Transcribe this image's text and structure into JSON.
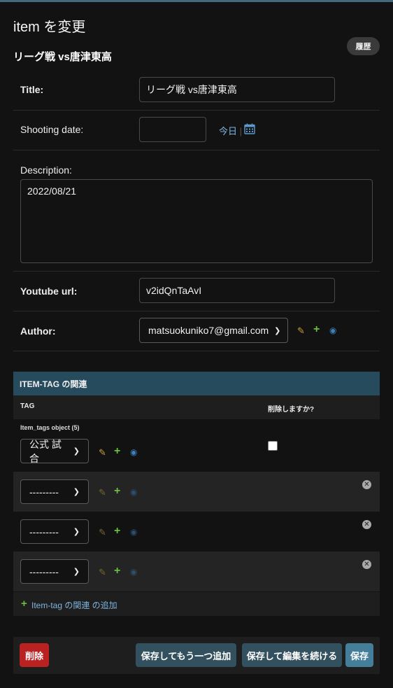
{
  "page": {
    "title": "item を変更",
    "object_title": "リーグ戦 vs唐津東高",
    "history_label": "履歴"
  },
  "form": {
    "title": {
      "label": "Title:",
      "value": "リーグ戦 vs唐津東高"
    },
    "shooting_date": {
      "label": "Shooting date:",
      "value": "",
      "today_label": "今日",
      "separator": "|"
    },
    "description": {
      "label": "Description:",
      "value": "2022/08/21"
    },
    "youtube_url": {
      "label": "Youtube url:",
      "value": "v2idQnTaAvI"
    },
    "author": {
      "label": "Author:",
      "value": "matsuokuniko7@gmail.com"
    }
  },
  "inline": {
    "header": "ITEM-TAG の関連",
    "col_tag": "TAG",
    "col_delete": "削除しますか?",
    "object_label": "Item_tags object (5)",
    "rows": [
      {
        "tag": "公式 試合"
      },
      {
        "tag": "---------"
      },
      {
        "tag": "---------"
      },
      {
        "tag": "---------"
      }
    ],
    "add_label": "Item-tag の関連 の追加"
  },
  "icons": {
    "pencil": "pencil-icon",
    "plus": "plus-icon",
    "eye": "eye-icon",
    "calendar": "calendar-icon",
    "delete": "delete-x-icon"
  },
  "submit": {
    "delete": "削除",
    "save_add_another": "保存してもう一つ追加",
    "save_continue": "保存して編集を続ける",
    "save": "保存"
  },
  "colors": {
    "background": "#121212",
    "header_bar": "#264b5d",
    "delete_button": "#ba2121",
    "primary_button": "#447e9b",
    "link": "#7fb6e0"
  }
}
